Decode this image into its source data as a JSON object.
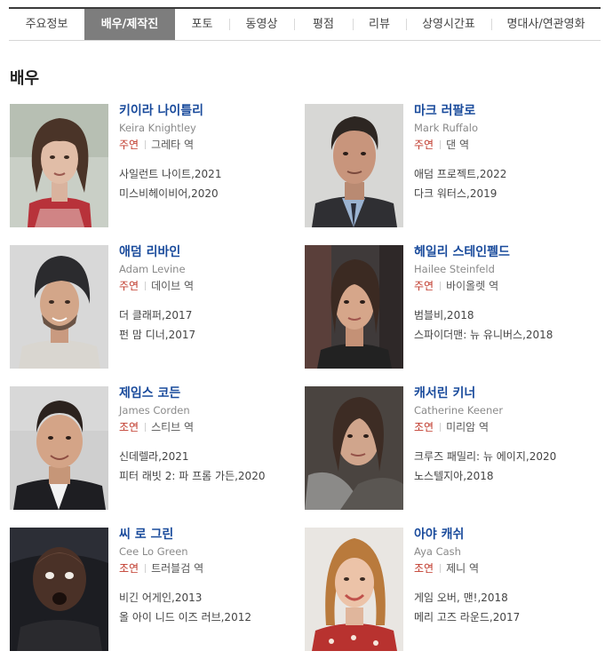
{
  "tabs": [
    {
      "label": "주요정보",
      "active": false
    },
    {
      "label": "배우/제작진",
      "active": true
    },
    {
      "label": "포토",
      "active": false
    },
    {
      "label": "동영상",
      "active": false
    },
    {
      "label": "평점",
      "active": false
    },
    {
      "label": "리뷰",
      "active": false
    },
    {
      "label": "상영시간표",
      "active": false
    },
    {
      "label": "명대사/연관영화",
      "active": false
    }
  ],
  "section_title": "배우",
  "actors": [
    {
      "name": "키이라 나이틀리",
      "english_name": "Keira Knightley",
      "role_type": "주연",
      "role": "그레타 역",
      "works": [
        "사일런트 나이트,2021",
        "미스비헤이비어,2020"
      ]
    },
    {
      "name": "마크 러팔로",
      "english_name": "Mark Ruffalo",
      "role_type": "주연",
      "role": "댄 역",
      "works": [
        "애덤 프로젝트,2022",
        "다크 워터스,2019"
      ]
    },
    {
      "name": "애덤 리바인",
      "english_name": "Adam Levine",
      "role_type": "주연",
      "role": "데이브 역",
      "works": [
        "더 클래퍼,2017",
        "펀 맘 디너,2017"
      ]
    },
    {
      "name": "헤일리 스테인펠드",
      "english_name": "Hailee Steinfeld",
      "role_type": "주연",
      "role": "바이올렛 역",
      "works": [
        "범블비,2018",
        "스파이더맨: 뉴 유니버스,2018"
      ]
    },
    {
      "name": "제임스 코든",
      "english_name": "James Corden",
      "role_type": "조연",
      "role": "스티브 역",
      "works": [
        "신데렐라,2021",
        "피터 래빗 2: 파 프롬 가든,2020"
      ]
    },
    {
      "name": "캐서린 키너",
      "english_name": "Catherine Keener",
      "role_type": "조연",
      "role": "미리암 역",
      "works": [
        "크루즈 패밀리: 뉴 에이지,2020",
        "노스텔지아,2018"
      ]
    },
    {
      "name": "씨 로 그린",
      "english_name": "Cee Lo Green",
      "role_type": "조연",
      "role": "트러블검 역",
      "works": [
        "비긴 어게인,2013",
        "올 아이 니드 이즈 러브,2012"
      ]
    },
    {
      "name": "아야 캐쉬",
      "english_name": "Aya Cash",
      "role_type": "조연",
      "role": "제니 역",
      "works": [
        "게임 오버, 맨!,2018",
        "메리 고즈 라운드,2017"
      ]
    }
  ]
}
